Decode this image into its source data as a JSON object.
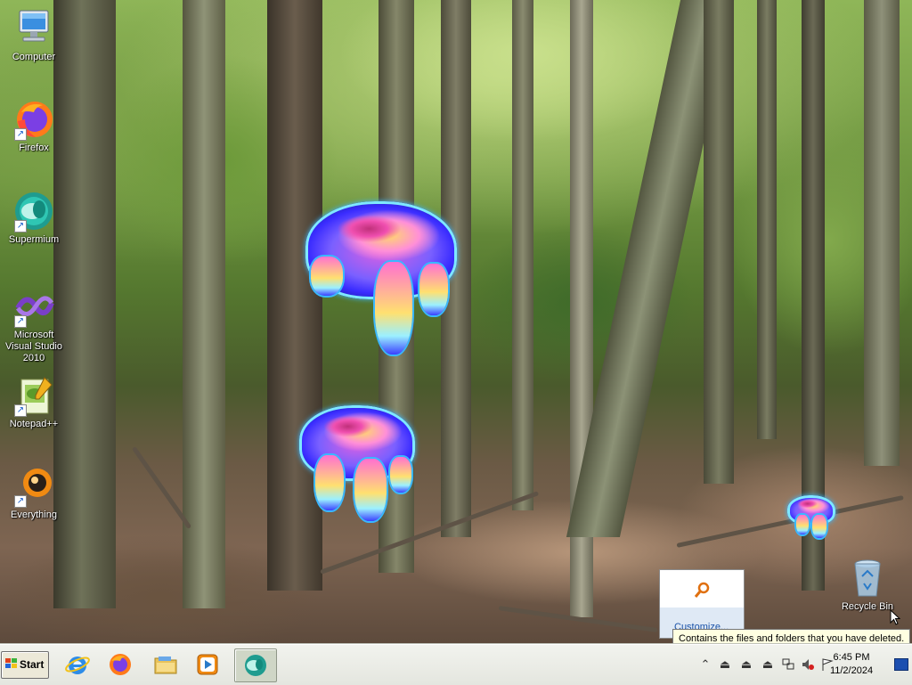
{
  "desktop": {
    "wallpaper": "forest",
    "icons": [
      {
        "label": "Computer",
        "icon": "computer-icon"
      },
      {
        "label": "Firefox",
        "icon": "firefox-icon"
      },
      {
        "label": "Supermium",
        "icon": "supermium-icon"
      },
      {
        "label": "Microsoft Visual Studio 2010",
        "icon": "visual-studio-icon"
      },
      {
        "label": "Notepad++",
        "icon": "notepadpp-icon"
      },
      {
        "label": "Everything",
        "icon": "everything-icon"
      },
      {
        "label": "Recycle Bin",
        "icon": "recycle-bin-icon"
      }
    ]
  },
  "tray_popup": {
    "link_label": "Customize...",
    "icon": "magnifier-icon"
  },
  "tooltip": {
    "text": "Contains the files and folders that you have deleted."
  },
  "taskbar": {
    "start_label": "Start",
    "pinned_apps": [
      {
        "name": "Internet Explorer",
        "icon": "internet-explorer-icon"
      },
      {
        "name": "Firefox",
        "icon": "firefox-icon"
      },
      {
        "name": "File Explorer",
        "icon": "folder-icon"
      },
      {
        "name": "Media Player",
        "icon": "media-player-icon"
      },
      {
        "name": "Supermium",
        "icon": "supermium-icon"
      }
    ],
    "tray": {
      "clock_time": "6:45 PM",
      "clock_date": "11/2/2024"
    }
  },
  "colors": {
    "taskbar": "#e8e9e3",
    "tooltip_bg": "#ffffe1",
    "link": "#1a52a8"
  }
}
